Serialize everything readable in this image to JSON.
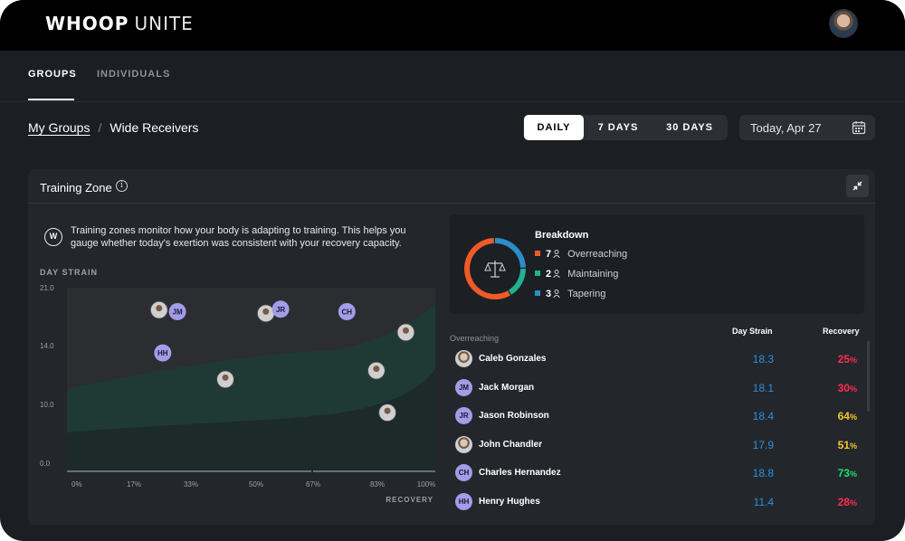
{
  "app": {
    "brand_primary": "WHOOP",
    "brand_secondary": "UNITE",
    "avatar_icon": "user-avatar-photo"
  },
  "tabs": [
    {
      "label": "GROUPS",
      "active": true
    },
    {
      "label": "INDIVIDUALS",
      "active": false
    }
  ],
  "breadcrumb": {
    "parent": "My Groups",
    "separator": "/",
    "current": "Wide Receivers"
  },
  "range": {
    "options": [
      "DAILY",
      "7 DAYS",
      "30 DAYS"
    ],
    "selected": "DAILY"
  },
  "date": {
    "value": "Today, Apr 27",
    "icon": "calendar-icon"
  },
  "panel": {
    "title": "Training Zone",
    "description": "Training zones monitor how your body is adapting to training. This helps you gauge whether today's exertion was consistent with your recovery capacity."
  },
  "chart_data": {
    "type": "scatter",
    "ylabel": "DAY STRAIN",
    "xlabel": "RECOVERY",
    "y_ticks": [
      "21.0",
      "14.0",
      "10.0",
      "0.0"
    ],
    "x_ticks": [
      "0%",
      "17%",
      "33%",
      "50%",
      "67%",
      "83%",
      "100%"
    ],
    "points": [
      {
        "initials": "",
        "recovery": 25,
        "strain": 18.3,
        "kind": "photo"
      },
      {
        "initials": "JM",
        "recovery": 30,
        "strain": 18.1,
        "kind": "initials"
      },
      {
        "initials": "",
        "recovery": 54,
        "strain": 17.9,
        "kind": "photo"
      },
      {
        "initials": "JR",
        "recovery": 58,
        "strain": 18.4,
        "kind": "initials"
      },
      {
        "initials": "CH",
        "recovery": 76,
        "strain": 18.1,
        "kind": "initials"
      },
      {
        "initials": "",
        "recovery": 92,
        "strain": 15.6,
        "kind": "photo"
      },
      {
        "initials": "HH",
        "recovery": 26,
        "strain": 13.5,
        "kind": "initials"
      },
      {
        "initials": "",
        "recovery": 43,
        "strain": 11.7,
        "kind": "photo"
      },
      {
        "initials": "",
        "recovery": 84,
        "strain": 12.3,
        "kind": "photo"
      },
      {
        "initials": "",
        "recovery": 87,
        "strain": 8.6,
        "kind": "photo"
      }
    ],
    "colors": {
      "point": "#a39ce8",
      "zone_top": "#2b2d31",
      "zone_mid": "#1f3a34",
      "zone_low": "#1d2a2a"
    }
  },
  "breakdown": {
    "title": "Breakdown",
    "items": [
      {
        "count": "7",
        "label": "Overreaching",
        "color": "#f05a28"
      },
      {
        "count": "2",
        "label": "Maintaining",
        "color": "#1fb292"
      },
      {
        "count": "3",
        "label": "Tapering",
        "color": "#2a8ec9"
      }
    ],
    "icon": "balance-scale-icon"
  },
  "table": {
    "section": "Overreaching",
    "col_strain": "Day Strain",
    "col_recovery": "Recovery",
    "rows": [
      {
        "avatar": "",
        "name": "Caleb Gonzales",
        "strain": "18.3",
        "recovery": "25",
        "rec_color": "#ff2b4e"
      },
      {
        "avatar": "JM",
        "name": "Jack Morgan",
        "strain": "18.1",
        "recovery": "30",
        "rec_color": "#ff2b4e"
      },
      {
        "avatar": "JR",
        "name": "Jason Robinson",
        "strain": "18.4",
        "recovery": "64",
        "rec_color": "#f7c531"
      },
      {
        "avatar": "",
        "name": "John Chandler",
        "strain": "17.9",
        "recovery": "51",
        "rec_color": "#f7c531"
      },
      {
        "avatar": "CH",
        "name": "Charles Hernandez",
        "strain": "18.8",
        "recovery": "73",
        "rec_color": "#19e36b"
      },
      {
        "avatar": "HH",
        "name": "Henry Hughes",
        "strain": "11.4",
        "recovery": "28",
        "rec_color": "#ff2b4e"
      }
    ],
    "percent_sign": "%"
  }
}
